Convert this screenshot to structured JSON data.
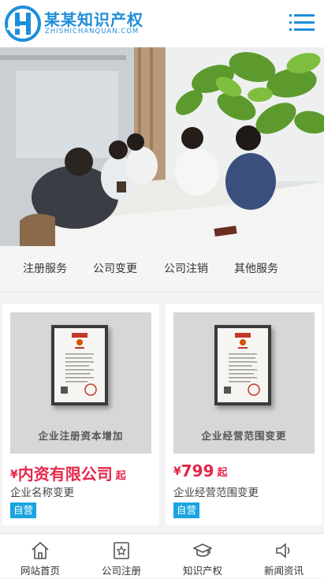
{
  "header": {
    "logo_title": "某某知识产权",
    "logo_subtitle": "ZHISHICHANQUAN.COM",
    "menu_icon": "hamburger-menu-icon",
    "brand_color": "#1e8ed9"
  },
  "subnav": {
    "items": [
      {
        "label": "注册服务"
      },
      {
        "label": "公司变更"
      },
      {
        "label": "公司注销"
      },
      {
        "label": "其他服务"
      }
    ]
  },
  "products": [
    {
      "image_caption": "企业注册资本增加",
      "price_symbol": "¥",
      "price": "内资有限公司",
      "price_suffix": "起",
      "name": "企业名称变更",
      "badge": "自营"
    },
    {
      "image_caption": "企业经营范围变更",
      "price_symbol": "¥",
      "price": "799",
      "price_suffix": "起",
      "name": "企业经营范围变更",
      "badge": "自营"
    }
  ],
  "bottom_nav": {
    "items": [
      {
        "label": "网站首页",
        "icon": "home-icon"
      },
      {
        "label": "公司注册",
        "icon": "star-badge-icon"
      },
      {
        "label": "知识产权",
        "icon": "graduation-cap-icon"
      },
      {
        "label": "新闻资讯",
        "icon": "speaker-icon"
      }
    ]
  },
  "colors": {
    "price": "#e4274a",
    "badge": "#1aa4e0"
  }
}
